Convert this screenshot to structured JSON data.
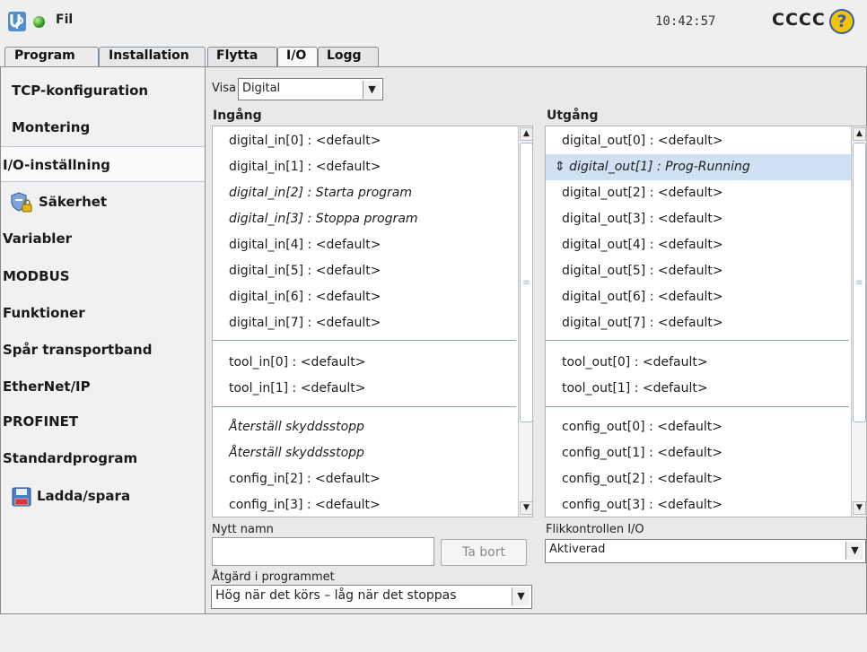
{
  "topbar": {
    "file_label": "Fil",
    "clock": "10:42:57",
    "robot_name": "CCCC",
    "help_symbol": "?"
  },
  "tabs": {
    "program": "Program",
    "installation": "Installation"
  },
  "subtabs": {
    "flytta": "Flytta",
    "io": "I/O",
    "logg": "Logg"
  },
  "sidebar": {
    "items": [
      {
        "label": "TCP-konfiguration"
      },
      {
        "label": "Montering"
      },
      {
        "label": "I/O-inställning"
      },
      {
        "label": "Säkerhet"
      },
      {
        "label": "Variabler"
      },
      {
        "label": "MODBUS"
      },
      {
        "label": "Funktioner"
      },
      {
        "label": "Spår transportband"
      },
      {
        "label": "EtherNet/IP"
      },
      {
        "label": "PROFINET"
      },
      {
        "label": "Standardprogram"
      },
      {
        "label": "Ladda/spara"
      }
    ]
  },
  "view": {
    "label": "Visa",
    "selected": "Digital"
  },
  "input_list": {
    "header": "Ingång",
    "rows": [
      "digital_in[0]  :  <default>",
      "digital_in[1]  :  <default>",
      "digital_in[2]  :  Starta program",
      "digital_in[3]  :  Stoppa program",
      "digital_in[4]  :  <default>",
      "digital_in[5]  :  <default>",
      "digital_in[6]  :  <default>",
      "digital_in[7]  :  <default>",
      "tool_in[0]     :  <default>",
      "tool_in[1]     :  <default>",
      "Återställ skyddsstopp",
      "Återställ skyddsstopp",
      "config_in[2]  :  <default>",
      "config_in[3]  :  <default>"
    ]
  },
  "output_list": {
    "header": "Utgång",
    "rows": [
      "digital_out[0] :  <default>",
      "⇕ digital_out[1] :  Prog-Running",
      "digital_out[2] :  <default>",
      "digital_out[3] :  <default>",
      "digital_out[4] :  <default>",
      "digital_out[5] :  <default>",
      "digital_out[6] :  <default>",
      "digital_out[7] :  <default>",
      "tool_out[0]    :  <default>",
      "tool_out[1]    :  <default>",
      "config_out[0]  :  <default>",
      "config_out[1]  :  <default>",
      "config_out[2]  :  <default>",
      "config_out[3]  :  <default>"
    ]
  },
  "new_name": {
    "label": "Nytt namn",
    "value": "",
    "delete_button": "Ta bort"
  },
  "action": {
    "label": "Åtgärd i programmet",
    "selected": "Hög när det körs – låg när det stoppas"
  },
  "tab_control": {
    "label": "Flikkontrollen I/O",
    "selected": "Aktiverad"
  },
  "scroll_symbols": {
    "up": "▲",
    "down": "▼",
    "grip": "≡"
  },
  "colors": {
    "highlight": "#cfe1f2",
    "separator": "#8aa2bd",
    "status_green": "#2f9a1e"
  }
}
